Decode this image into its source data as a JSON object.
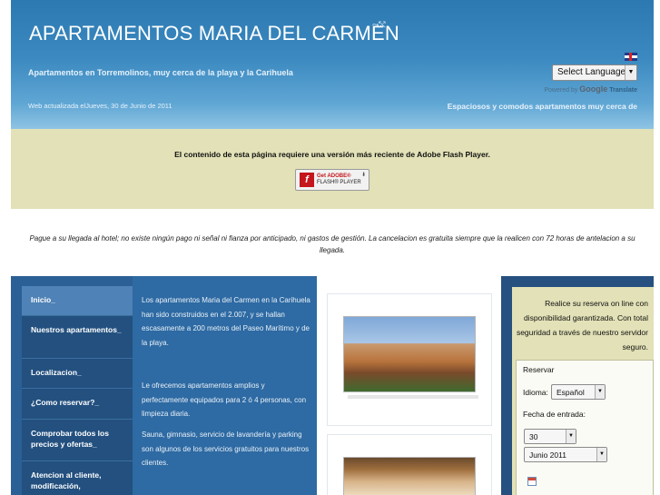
{
  "header": {
    "title": "APARTAMENTOS MARIA DEL CARMEN",
    "title_mark": "⤳⤲",
    "tagline": "Apartamentos en Torremolinos, muy cerca de la playa y la Carihuela",
    "updated": "Web actualizada elJueves, 30 de Junio de 2011",
    "marquee": "Espaciosos y comodos apartamentos muy cerca de",
    "language_select": "Select Language",
    "powered_prefix": "Powered by",
    "google": "Google",
    "translate": "Translate"
  },
  "flash": {
    "message": "El contenido de esta página requiere una versión más reciente de Adobe Flash Player.",
    "button_line1": "Get ADOBE®",
    "button_line2": "FLASH® PLAYER",
    "logo_letter": "f"
  },
  "notice": "Pague a su llegada al hotel; no existe ningún pago ni señal ni fianza por anticipado, ni gastos de gestión. La cancelacion es gratuita siempre que la realicen con 72 horas de antelacion a su llegada.",
  "nav": [
    {
      "label": "Inicio_"
    },
    {
      "label": "Nuestros apartamentos_"
    },
    {
      "label": "Localizacion_"
    },
    {
      "label": "¿Como reservar?_"
    },
    {
      "label": "Comprobar todos los precios y ofertas_"
    },
    {
      "label": "Atencion al cliente, modificación,"
    }
  ],
  "main": {
    "p1": "Los apartamentos Maria del Carmen en la Carihuela han sido construidos en el 2.007, y se hallan escasamente a 200 metros del Paseo Marítimo y de la playa.",
    "p2": "Le ofrecemos apartamentos amplios y perfectamente equipados para 2 ó 4 personas, con limpieza diaria.",
    "p3": "Sauna, gimnasio, servicio de lavandería y parking son algunos de los servicios gratuitos para nuestros clientes."
  },
  "booking": {
    "intro": "Realice su reserva on line con disponibilidad garantizada. Con total seguridad a través de nuestro servidor seguro.",
    "reservar_label": "Reservar",
    "idioma_label": "Idioma:",
    "idioma_value": "Español",
    "fecha_label": "Fecha de entrada:",
    "day_value": "30",
    "month_value": "Junio 2011"
  },
  "icons": {
    "flag": "uk-flag-icon",
    "calendar": "calendar-icon",
    "flash": "flash-player-icon"
  },
  "colors": {
    "header_blue": "#2c79b1",
    "band_beige": "#e2e1b7",
    "sidebar_blue": "#2b6096",
    "nav_active": "#4f82b6"
  }
}
